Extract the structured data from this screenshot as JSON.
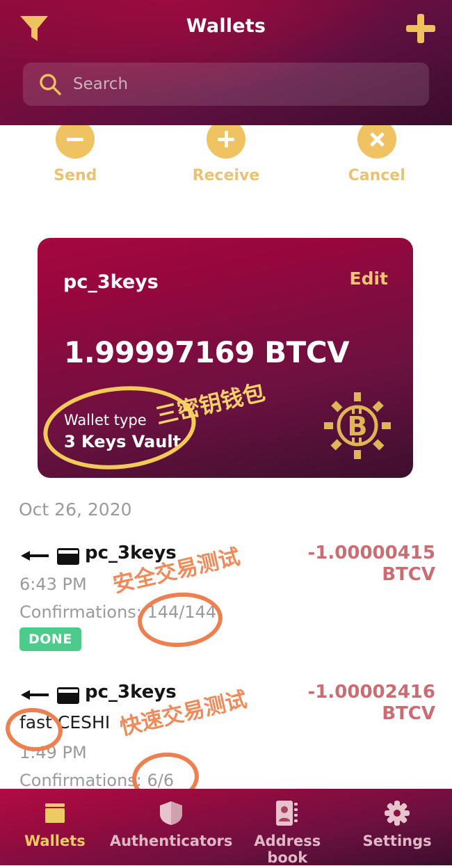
{
  "header": {
    "title": "Wallets",
    "filter_icon": "filter-funnel-icon",
    "add_icon": "plus-icon",
    "search": {
      "icon": "search-icon",
      "value": "",
      "placeholder": "Search"
    }
  },
  "actions": [
    {
      "label": "Send",
      "icon": "minus-circle-icon"
    },
    {
      "label": "Receive",
      "icon": "plus-circle-icon"
    },
    {
      "label": "Cancel",
      "icon": "close-circle-icon"
    }
  ],
  "wallet_card": {
    "name": "pc_3keys",
    "edit_label": "Edit",
    "balance": "1.99997169 BTCV",
    "type_label": "Wallet type",
    "type_value": "3 Keys Vault",
    "logo_icon": "btcv-coin-icon"
  },
  "transactions": {
    "date_header": "Oct 26, 2020",
    "items": [
      {
        "wallet": "pc_3keys",
        "note": "",
        "time": "6:43 PM",
        "confirmations": "Confirmations: 144/144",
        "status": "DONE",
        "amount": "-1.00000415",
        "currency": "BTCV",
        "direction_icon": "arrow-left-icon",
        "card_icon": "wallet-card-icon"
      },
      {
        "wallet": "pc_3keys",
        "note": "fast CESHI",
        "time": "1:49 PM",
        "confirmations": "Confirmations: 6/6",
        "status": "",
        "amount": "-1.00002416",
        "currency": "BTCV",
        "direction_icon": "arrow-left-icon",
        "card_icon": "wallet-card-icon"
      }
    ]
  },
  "annotations": {
    "wallet_type_cn": "三密钥钱包",
    "tx1_cn": "安全交易测试",
    "tx2_cn": "快速交易测试"
  },
  "bottom_nav": [
    {
      "label": "Wallets",
      "icon": "wallet-icon",
      "active": true
    },
    {
      "label": "Authenticators",
      "icon": "shield-icon",
      "active": false
    },
    {
      "label": "Address book",
      "icon": "address-book-icon",
      "active": false
    },
    {
      "label": "Settings",
      "icon": "gear-icon",
      "active": false
    }
  ],
  "colors": {
    "brand_crimson": "#9a0b3f",
    "accent_gold": "#efc362",
    "status_done_green": "#4ecb8c",
    "amount_negative_red": "#cb6b72",
    "annotation_orange": "#ee7f4e",
    "annotation_yellow": "#f2ca57"
  }
}
